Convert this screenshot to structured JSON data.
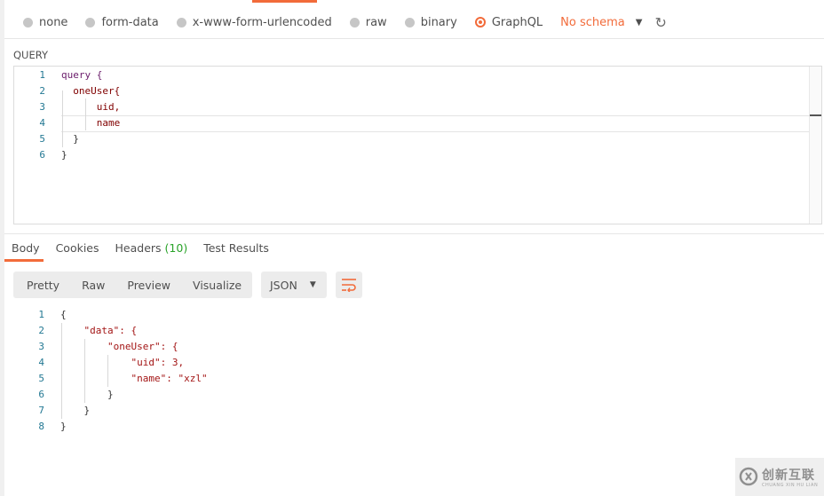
{
  "body_types": {
    "options": [
      "none",
      "form-data",
      "x-www-form-urlencoded",
      "raw",
      "binary",
      "GraphQL"
    ],
    "selected": "GraphQL",
    "schema_label": "No schema"
  },
  "query": {
    "label": "QUERY",
    "lines": [
      {
        "n": "1",
        "text": "query {"
      },
      {
        "n": "2",
        "text": "  oneUser{"
      },
      {
        "n": "3",
        "text": "      uid,"
      },
      {
        "n": "4",
        "text": "      name"
      },
      {
        "n": "5",
        "text": "  }"
      },
      {
        "n": "6",
        "text": "}"
      }
    ]
  },
  "response_tabs": {
    "body": "Body",
    "cookies": "Cookies",
    "headers": "Headers",
    "headers_count": "(10)",
    "tests": "Test Results"
  },
  "view_modes": [
    "Pretty",
    "Raw",
    "Preview",
    "Visualize"
  ],
  "format": "JSON",
  "response": {
    "lines": [
      {
        "n": "1",
        "text": "{"
      },
      {
        "n": "2",
        "text": "    \"data\": {"
      },
      {
        "n": "3",
        "text": "        \"oneUser\": {"
      },
      {
        "n": "4",
        "text": "            \"uid\": 3,"
      },
      {
        "n": "5",
        "text": "            \"name\": \"xzl\""
      },
      {
        "n": "6",
        "text": "        }"
      },
      {
        "n": "7",
        "text": "    }"
      },
      {
        "n": "8",
        "text": "}"
      }
    ]
  },
  "watermark": {
    "text": "创新互联",
    "sub": "CHUANG XIN HU LIAN"
  },
  "colors": {
    "accent": "#f26b3a",
    "count_green": "#29a329"
  },
  "icons": {
    "refresh": "refresh-icon",
    "dropdown": "chevron-down-icon",
    "wrap": "wrap-lines-icon"
  }
}
